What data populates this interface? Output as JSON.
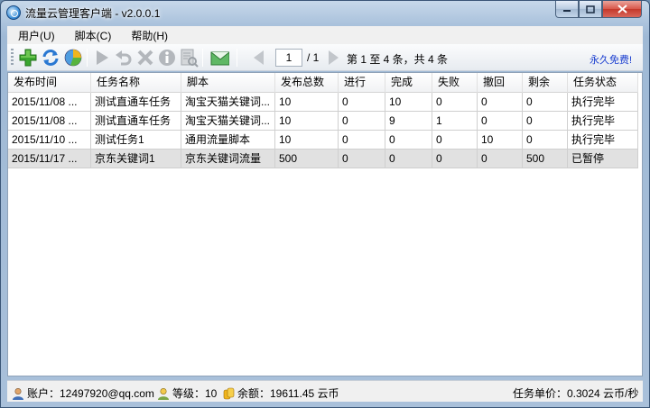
{
  "window": {
    "title": "流量云管理客户端 - v2.0.0.1"
  },
  "menu": [
    {
      "label": "用户(U)"
    },
    {
      "label": "脚本(C)"
    },
    {
      "label": "帮助(H)"
    }
  ],
  "toolbar": {
    "page_value": "1",
    "page_total": "/ 1",
    "page_info": "第 1 至 4 条，共 4 条",
    "free_link": "永久免费!"
  },
  "table": {
    "columns": [
      "发布时间",
      "任务名称",
      "脚本",
      "发布总数",
      "进行",
      "完成",
      "失败",
      "撤回",
      "剩余",
      "任务状态"
    ],
    "rows": [
      {
        "cells": [
          "2015/11/08 ...",
          "测试直通车任务",
          "淘宝天猫关键词...",
          "10",
          "0",
          "10",
          "0",
          "0",
          "0",
          "执行完毕"
        ],
        "paused": false
      },
      {
        "cells": [
          "2015/11/08 ...",
          "测试直通车任务",
          "淘宝天猫关键词...",
          "10",
          "0",
          "9",
          "1",
          "0",
          "0",
          "执行完毕"
        ],
        "paused": false
      },
      {
        "cells": [
          "2015/11/10 ...",
          "测试任务1",
          "通用流量脚本",
          "10",
          "0",
          "0",
          "0",
          "10",
          "0",
          "执行完毕"
        ],
        "paused": false
      },
      {
        "cells": [
          "2015/11/17 ...",
          "京东关键词1",
          "京东关键词流量",
          "500",
          "0",
          "0",
          "0",
          "0",
          "500",
          "已暂停"
        ],
        "paused": true
      }
    ]
  },
  "status": {
    "account": "账户：12497920@qq.com",
    "level": "等级：10",
    "balance": "余额：19611.45 云币",
    "unit_price": "任务单价：0.3024 云币/秒"
  },
  "colors": {
    "link": "#1b3fd0",
    "add_icon": "#3aa62f",
    "refresh_icon": "#2a78d2",
    "paused_row": "#e1e1e1"
  }
}
